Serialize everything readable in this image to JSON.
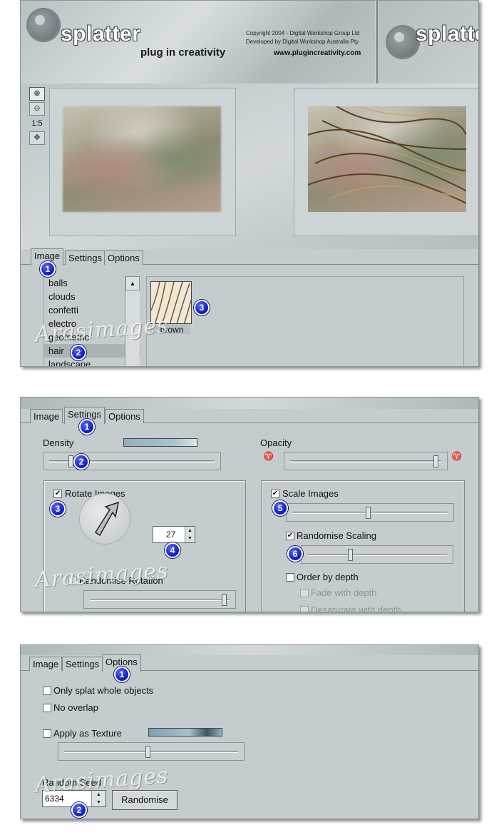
{
  "brand": {
    "title": "splatter",
    "subtitle": "plug in creativity",
    "copyright_line1": "Copyright 2004 - Digital Workshop Group Ltd",
    "copyright_line2": "Developed by Digital Workshop Australia Pty",
    "url": "www.plugincreativity.com"
  },
  "zoom": {
    "ratio_label": "1:5"
  },
  "tabs": {
    "image": "Image",
    "settings": "Settings",
    "options": "Options"
  },
  "image_panel": {
    "categories": [
      "balls",
      "clouds",
      "confetti",
      "electro",
      "geometric",
      "hair",
      "landscape"
    ],
    "selected_category": "hair",
    "thumbnail_label": "brown"
  },
  "settings_panel": {
    "density_label": "Density",
    "opacity_label": "Opacity",
    "rotate_images_label": "Rotate Images",
    "rotate_images_checked": true,
    "rotation_value": "27",
    "randomise_rotation_label": "Randomise Rotation",
    "scale_images_label": "Scale Images",
    "scale_images_checked": true,
    "randomise_scaling_label": "Randomise Scaling",
    "randomise_scaling_checked": true,
    "order_by_depth_label": "Order by depth",
    "fade_with_depth_label": "Fade with depth",
    "desaturate_with_depth_label": "Desaturate with depth",
    "density_level": 0.12,
    "opacity_level": 0.98,
    "scale_level": 0.49,
    "random_scaling_level": 0.3,
    "random_rotation_level": 0.98
  },
  "options_panel": {
    "only_splat_label": "Only splat whole objects",
    "no_overlap_label": "No overlap",
    "apply_texture_label": "Apply as Texture",
    "random_seed_label": "Random Seed",
    "seed_value": "6334",
    "randomise_button": "Randomise",
    "texture_level": 0.48
  },
  "watermark": "Arasimages",
  "badges": {
    "n1": "1",
    "n2": "2",
    "n3": "3",
    "n4": "4",
    "n5": "5",
    "n6": "6"
  },
  "colors": {
    "panel_bg": "#c5cccd",
    "badge_blue": "#0c1ac2"
  }
}
